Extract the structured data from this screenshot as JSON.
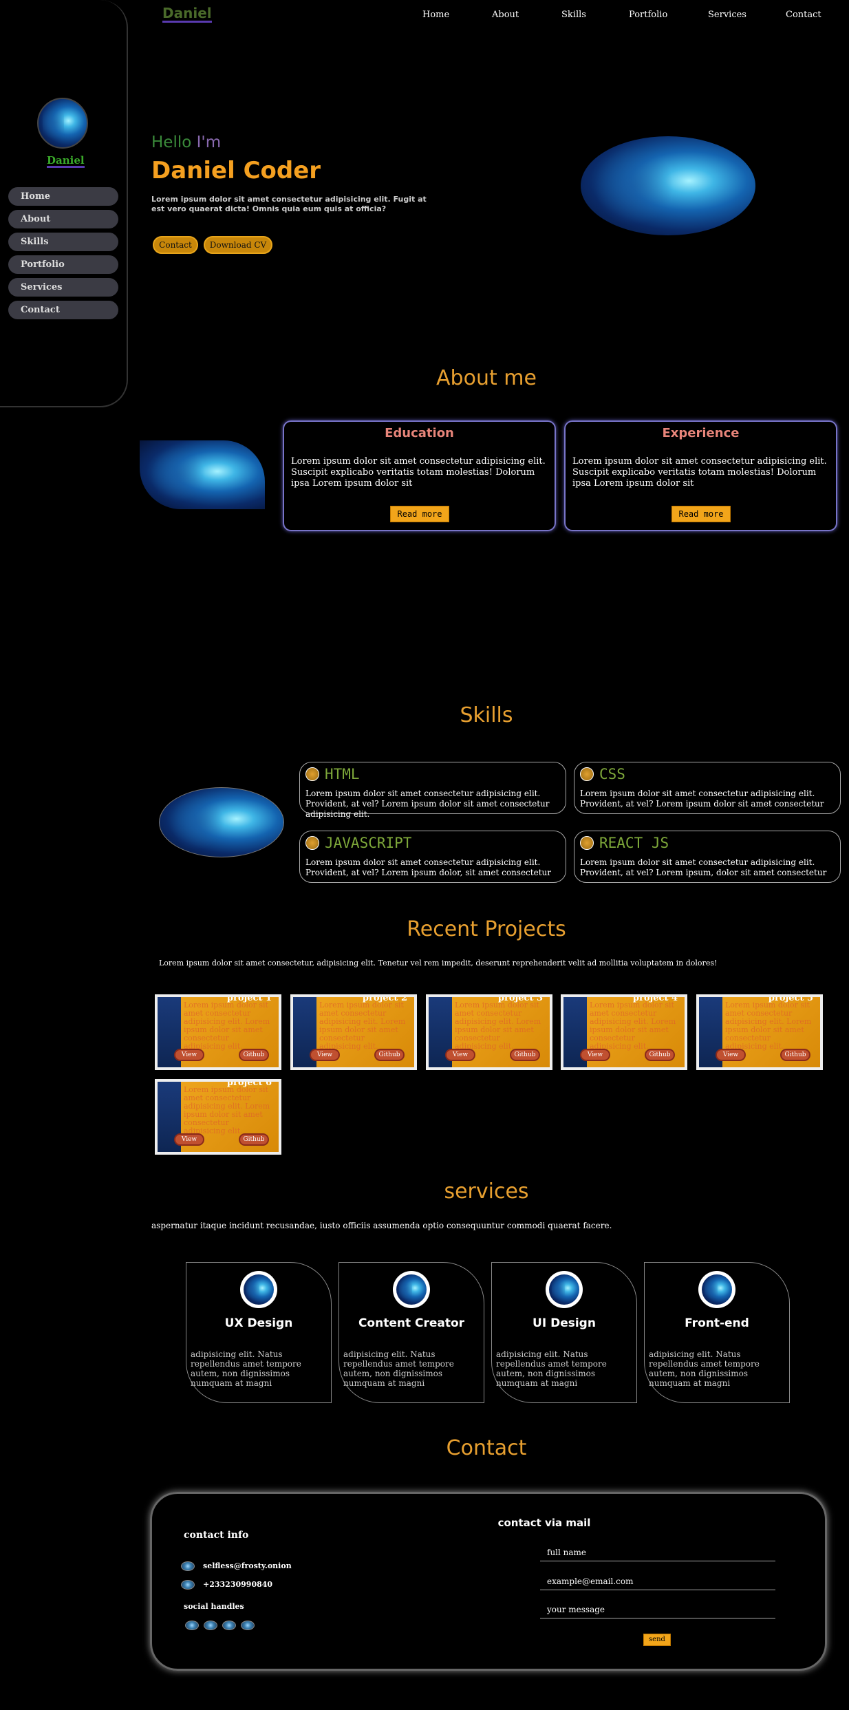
{
  "brand": "Daniel",
  "nav": [
    "Home",
    "About",
    "Skills",
    "Portfolio",
    "Services",
    "Contact"
  ],
  "sidebar": {
    "name": "Daniel",
    "items": [
      "Home",
      "About",
      "Skills",
      "Portfolio",
      "Services",
      "Contact"
    ]
  },
  "hero": {
    "hello": "Hello",
    "im": "I'm",
    "name": "Daniel Coder",
    "text": "Lorem ipsum dolor sit amet consectetur adipisicing elit. Fugit at est vero quaerat dicta! Omnis quia eum quis at officia?",
    "contact_label": "Contact",
    "cv_label": "Download CV"
  },
  "about": {
    "heading": "About me",
    "education": {
      "title": "Education",
      "text": "Lorem ipsum dolor sit amet consectetur adipisicing elit. Suscipit explicabo veritatis totam molestias! Dolorum ipsa Lorem ipsum dolor sit",
      "button": "Read more"
    },
    "experience": {
      "title": "Experience",
      "text": "Lorem ipsum dolor sit amet consectetur adipisicing elit. Suscipit explicabo veritatis totam molestias! Dolorum ipsa Lorem ipsum dolor sit",
      "button": "Read more"
    }
  },
  "skills": {
    "heading": "Skills",
    "items": [
      {
        "name": "HTML",
        "text": "Lorem ipsum dolor sit amet consectetur adipisicing elit. Provident, at vel? Lorem ipsum dolor sit amet consectetur adipisicing elit."
      },
      {
        "name": "CSS",
        "text": "Lorem ipsum dolor sit amet consectetur adipisicing elit. Provident, at vel? Lorem ipsum dolor sit amet consectetur"
      },
      {
        "name": "JAVASCRIPT",
        "text": "Lorem ipsum dolor sit amet consectetur adipisicing elit. Provident, at vel? Lorem ipsum dolor, sit amet consectetur"
      },
      {
        "name": "REACT JS",
        "text": "Lorem ipsum dolor sit amet consectetur adipisicing elit. Provident, at vel? Lorem ipsum, dolor sit amet consectetur"
      }
    ]
  },
  "projects": {
    "heading": "Recent Projects",
    "intro": "Lorem ipsum dolor sit amet consectetur, adipisicing elit. Tenetur vel rem impedit, deserunt reprehenderit velit ad mollitia voluptatem in dolores!",
    "item_text": "Lorem ipsum dolor sit amet consectetur adipisicing elit. Lorem ipsum dolor sit amet consectetur adipisicing elit.",
    "view_label": "View",
    "github_label": "Github",
    "items": [
      "project 1",
      "project 2",
      "project 3",
      "project 4",
      "project 5",
      "project 6"
    ]
  },
  "services": {
    "heading": "services",
    "intro": "aspernatur itaque incidunt recusandae, iusto officiis assumenda optio consequuntur commodi quaerat facere.",
    "items": [
      {
        "title": "UX Design",
        "text": "adipisicing elit. Natus repellendus amet tempore autem, non dignissimos numquam at magni"
      },
      {
        "title": "Content Creator",
        "text": "adipisicing elit. Natus repellendus amet tempore autem, non dignissimos numquam at magni"
      },
      {
        "title": "UI Design",
        "text": "adipisicing elit. Natus repellendus amet tempore autem, non dignissimos numquam at magni"
      },
      {
        "title": "Front-end",
        "text": "adipisicing elit. Natus repellendus amet tempore autem, non dignissimos numquam at magni"
      }
    ]
  },
  "contact": {
    "heading": "Contact",
    "info_title": "contact info",
    "email": "selfless@frosty.onion",
    "phone": "+233230990840",
    "social_title": "social handles",
    "mail_title": "contact via mail",
    "fullname_placeholder": "full name",
    "email_placeholder": "example@email.com",
    "message_placeholder": "your message",
    "send_label": "send"
  },
  "colors": {
    "accent": "#e8a030",
    "card_border": "#7874c8",
    "skill_name": "#7ea83a"
  }
}
